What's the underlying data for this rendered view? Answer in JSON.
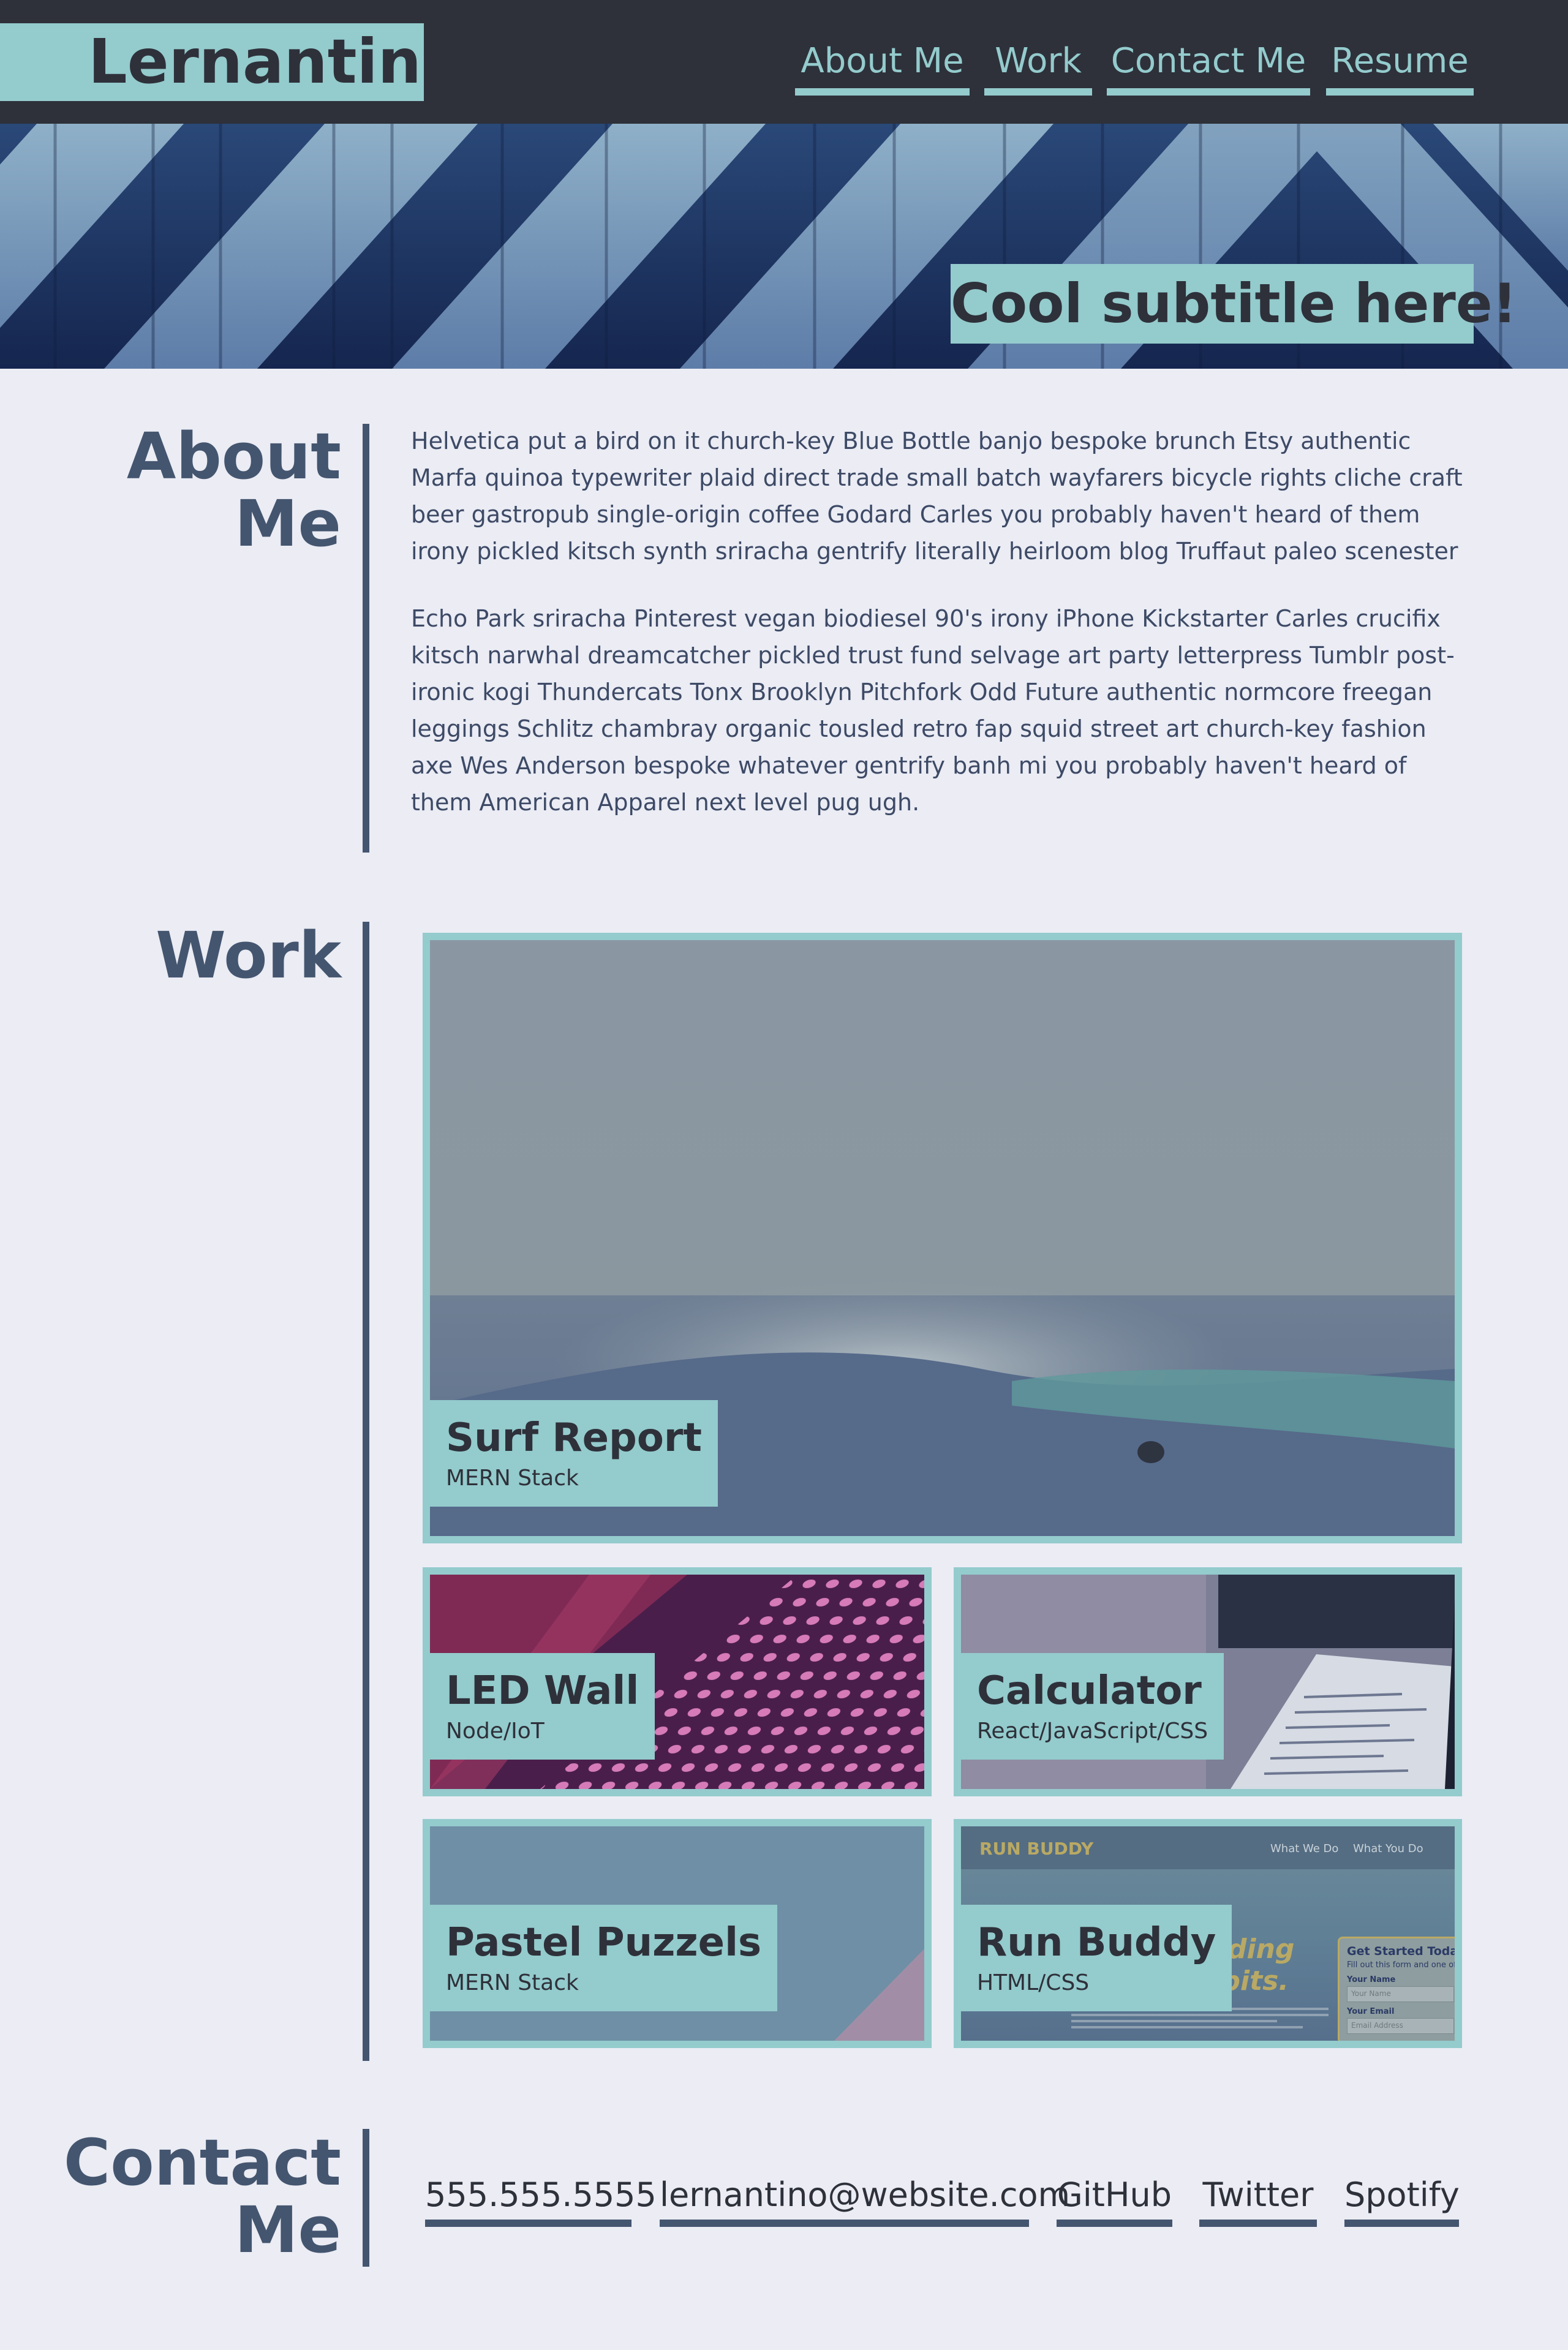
{
  "header": {
    "brand": "Lernantino",
    "nav": [
      {
        "label": "About Me"
      },
      {
        "label": "Work"
      },
      {
        "label": "Contact Me"
      },
      {
        "label": "Resume"
      }
    ]
  },
  "hero": {
    "subtitle": "Cool subtitle here!"
  },
  "about": {
    "title_line1": "About",
    "title_line2": "Me",
    "paragraphs": [
      "Helvetica put a bird on it church-key Blue Bottle banjo bespoke brunch Etsy authentic Marfa quinoa typewriter plaid direct trade small batch wayfarers bicycle rights cliche craft beer gastropub single-origin coffee Godard Carles you probably haven't heard of them irony pickled kitsch synth sriracha gentrify literally heirloom blog Truffaut paleo scenester",
      "Echo Park sriracha Pinterest vegan biodiesel 90's irony iPhone Kickstarter Carles crucifix kitsch narwhal dreamcatcher pickled trust fund selvage art party letterpress Tumblr post-ironic kogi Thundercats Tonx Brooklyn Pitchfork Odd Future authentic normcore freegan leggings Schlitz chambray organic tousled retro fap squid street art church-key fashion axe Wes Anderson bespoke whatever gentrify banh mi you probably haven't heard of them American Apparel next level pug ugh."
    ]
  },
  "work": {
    "title": "Work",
    "projects": [
      {
        "title": "Surf Report",
        "stack": "MERN Stack"
      },
      {
        "title": "LED Wall",
        "stack": "Node/IoT"
      },
      {
        "title": "Calculator",
        "stack": "React/JavaScript/CSS"
      },
      {
        "title": "Pastel Puzzels",
        "stack": "MERN Stack"
      },
      {
        "title": "Run Buddy",
        "stack": "HTML/CSS"
      }
    ],
    "run_buddy_art": {
      "logo": "RUN BUDDY",
      "nav1": "What We Do",
      "nav2": "What You Do",
      "headline_line1": "Building",
      "headline_line2": "Habits.",
      "form_title": "Get Started Today",
      "form_sub": "Fill out this form and one of our",
      "name_label": "Your Name",
      "name_placeholder": "Your Name",
      "email_label": "Your Email",
      "email_placeholder": "Email Address"
    }
  },
  "contact": {
    "title_line1": "Contact",
    "title_line2": "Me",
    "links": [
      {
        "label": "555.555.5555"
      },
      {
        "label": "lernantino@website.com"
      },
      {
        "label": "GitHub"
      },
      {
        "label": "Twitter"
      },
      {
        "label": "Spotify"
      }
    ]
  },
  "colors": {
    "header_bg": "#2e313a",
    "accent_teal": "#94cbcd",
    "page_bg": "#ebecf4",
    "heading_slate": "#44556f"
  }
}
